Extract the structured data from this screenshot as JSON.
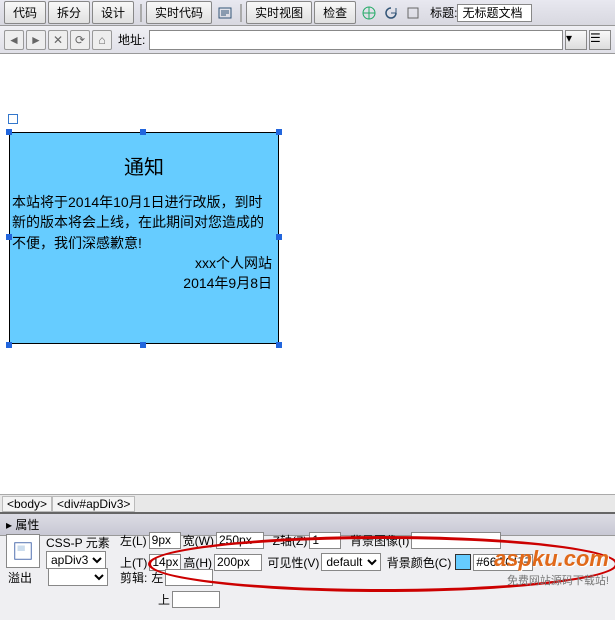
{
  "toolbar": {
    "tabs": {
      "code": "代码",
      "split": "拆分",
      "design": "设计"
    },
    "buttons": {
      "realtime_code": "实时代码",
      "realtime_view": "实时视图",
      "inspect": "检查"
    },
    "title_label": "标题:",
    "title_value": "无标题文档"
  },
  "address_bar": {
    "label": "地址:",
    "value": ""
  },
  "ap_div": {
    "title": "通知",
    "body": "本站将于2014年10月1日进行改版，到时新的版本将会上线，在此期间对您造成的不便，我们深感歉意!",
    "signature1": "xxx个人网站",
    "signature2": "2014年9月8日"
  },
  "tag_selector": {
    "body": "<body>",
    "div": "<div#apDiv3>"
  },
  "properties": {
    "panel_title": "属性",
    "element_label": "CSS-P 元素",
    "element_id": "apDiv3",
    "left_label": "左(L)",
    "left_value": "9px",
    "top_label": "上(T)",
    "top_value": "14px",
    "width_label": "宽(W)",
    "width_value": "250px",
    "height_label": "高(H)",
    "height_value": "200px",
    "z_label": "Z轴(Z)",
    "z_value": "1",
    "vis_label": "可见性(V)",
    "vis_value": "default",
    "bgimg_label": "背景图像(I)",
    "bgimg_value": "",
    "bgcolor_label": "背景颜色(C)",
    "bgcolor_value": "#66CCFF",
    "overflow_label": "溢出",
    "clip_label": "剪辑:",
    "clip_left": "左",
    "clip_top": "上"
  },
  "watermark": {
    "line1": "aspku.com",
    "line2": "免费网站源码下载站!"
  }
}
